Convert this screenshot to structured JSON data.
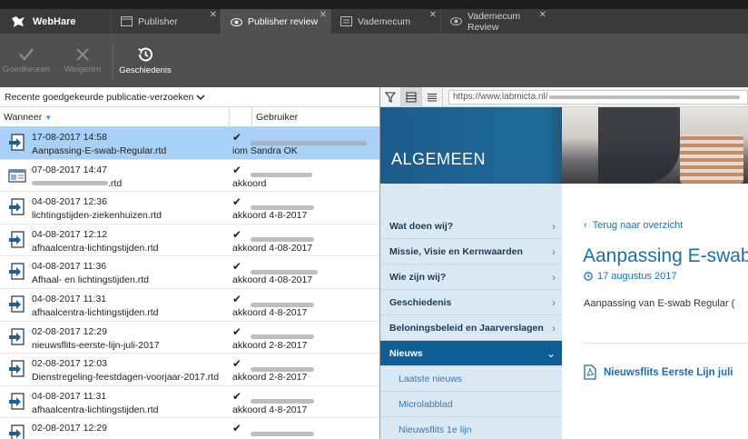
{
  "app": {
    "brand": "WebHare"
  },
  "tabs": [
    {
      "label": "Publisher",
      "active": false
    },
    {
      "label": "Publisher review",
      "active": true
    },
    {
      "label": "Vademecum",
      "active": false
    },
    {
      "label": "Vademecum Review",
      "active": false
    }
  ],
  "toolbar": {
    "approve_label": "Goedkeuren",
    "reject_label": "Weigeren",
    "history_label": "Geschiedenis"
  },
  "filter": {
    "selected": "Recente goedgekeurde publicatie-verzoeken"
  },
  "columns": {
    "when": "Wanneer",
    "user": "Gebruiker"
  },
  "rows": [
    {
      "date": "17-08-2017 14:58",
      "file": "Aanpassing-E-swab-Regular.rtd",
      "user": "iom Sandra OK",
      "status": "approved",
      "selected": true,
      "icon": "publish-document-icon"
    },
    {
      "date": "07-08-2017 14:47",
      "file": ".rtd",
      "user": "akkoord",
      "status": "approved",
      "selected": false,
      "icon": "web-page-icon"
    },
    {
      "date": "04-08-2017 12:36",
      "file": "lichtingstijden-ziekenhuizen.rtd",
      "user": "akkoord 4-8-2017",
      "status": "approved",
      "selected": false,
      "icon": "publish-document-icon"
    },
    {
      "date": "04-08-2017 12:12",
      "file": "afhaalcentra-lichtingstijden.rtd",
      "user": "akkoord 4-08-2017",
      "status": "approved",
      "selected": false,
      "icon": "publish-document-icon"
    },
    {
      "date": "04-08-2017 11:36",
      "file": "Afhaal- en lichtingstijden.rtd",
      "user": "akkoord 4-08-2017",
      "status": "approved",
      "selected": false,
      "icon": "publish-document-icon"
    },
    {
      "date": "04-08-2017 11:31",
      "file": "afhaalcentra-lichtingstijden.rtd",
      "user": "akkoord 4-8-2017",
      "status": "approved",
      "selected": false,
      "icon": "publish-document-icon"
    },
    {
      "date": "02-08-2017 12:29",
      "file": "nieuwsflits-eerste-lijn-juli-2017",
      "user": "akkoord 2-8-2017",
      "status": "approved",
      "selected": false,
      "icon": "publish-document-icon"
    },
    {
      "date": "02-08-2017 12:03",
      "file": "Dienstregeling-feestdagen-voorjaar-2017.rtd",
      "user": "akkoord 2-8-2017",
      "status": "approved",
      "selected": false,
      "icon": "publish-document-icon"
    },
    {
      "date": "04-08-2017 11:31",
      "file": "afhaalcentra-lichtingstijden.rtd",
      "user": "akkoord 4-8-2017",
      "status": "approved",
      "selected": false,
      "icon": "publish-document-icon"
    },
    {
      "date": "02-08-2017 12:29",
      "file": "",
      "user": "",
      "status": "approved",
      "selected": false,
      "icon": "publish-document-icon"
    }
  ],
  "preview": {
    "url": "https://www.labmicta.nl/",
    "hero_title": "ALGEMEEN",
    "nav": [
      {
        "label": "Wat doen wij?",
        "active": false
      },
      {
        "label": "Missie, Visie en Kernwaarden",
        "active": false
      },
      {
        "label": "Wie zijn wij?",
        "active": false
      },
      {
        "label": "Geschiedenis",
        "active": false
      },
      {
        "label": "Beloningsbeleid en Jaarverslagen",
        "active": false
      },
      {
        "label": "Nieuws",
        "active": true
      }
    ],
    "subnav": [
      "Laatste nieuws",
      "Microlabblad",
      "Nieuwsflits 1e lijn"
    ],
    "back_link": "Terug naar overzicht",
    "article_title": "Aanpassing E-swab",
    "article_date": "17 augustus 2017",
    "article_intro": "Aanpassing van E-swab Regular (",
    "pdf_link": "Nieuwsflits Eerste Lijn juli"
  },
  "colors": {
    "accent": "#1a6fae",
    "selection": "#a9d1f5",
    "nav_active": "#0f5f96",
    "toolbar_bg": "#505050"
  }
}
